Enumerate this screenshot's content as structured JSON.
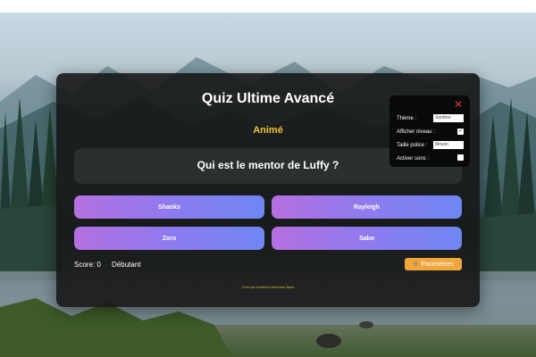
{
  "quiz": {
    "title": "Quiz Ultime Avancé",
    "category": "Animé",
    "question": "Qui est le mentor de Luffy ?",
    "answers": [
      "Shanks",
      "Rayleigh",
      "Zoro",
      "Sabo"
    ],
    "score_label": "Score: 0",
    "level_label": "Débutant",
    "params_icon": "gear-icon",
    "params_label": "Paramètres",
    "credit": "Créé par Ibrahima Mbemba Bakè"
  },
  "settings": {
    "close_icon": "close-icon",
    "theme_label": "Thème :",
    "theme_value": "Sombre",
    "show_level_label": "Afficher niveau :",
    "show_level_checked": true,
    "font_size_label": "Taille police :",
    "font_size_value": "Moyen",
    "sounds_label": "Activer sons :",
    "sounds_checked": false
  },
  "colors": {
    "accent": "#f1c232",
    "button_gradient_start": "#b46fe0",
    "button_gradient_end": "#6f86f2",
    "params_button": "#f0a63a",
    "close": "#e03030"
  }
}
